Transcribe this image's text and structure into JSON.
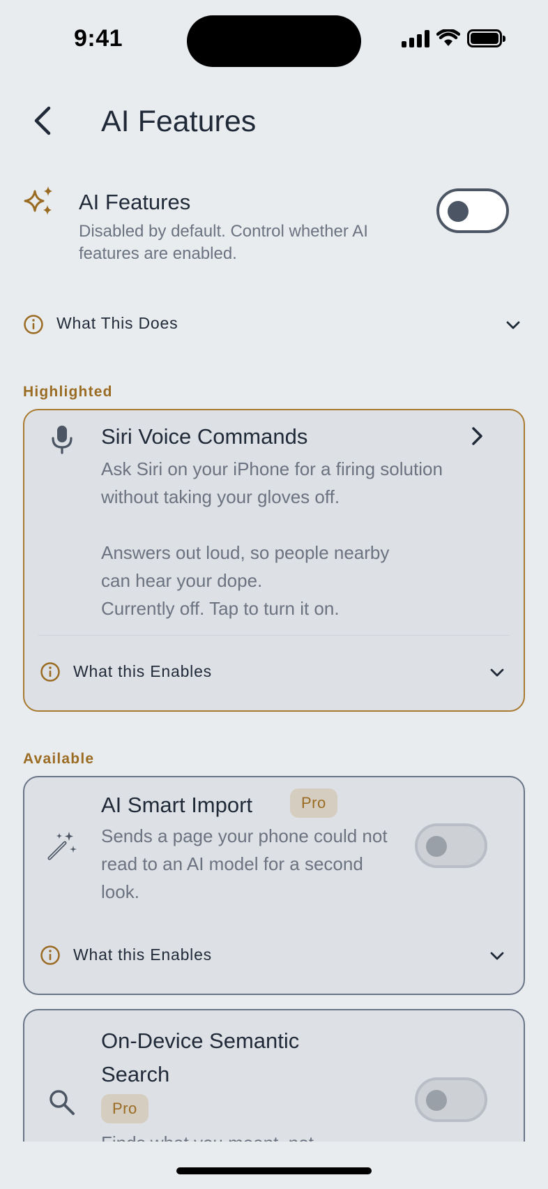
{
  "status": {
    "time": "9:41"
  },
  "nav": {
    "title": "AI Features"
  },
  "master": {
    "title": "AI Features",
    "description": "Disabled by default. Control whether AI features are enabled.",
    "icon": "sparkles-icon",
    "enabled": false
  },
  "what_this_does": {
    "label": "What This Does"
  },
  "sections": {
    "highlighted": "Highlighted",
    "available": "Available"
  },
  "siri": {
    "title": "Siri Voice Commands",
    "line1": "Ask Siri on your iPhone for a firing solution without taking your gloves off.",
    "line2": "Answers out loud, so people nearby can hear your dope.",
    "line3": "Currently off. Tap to turn it on.",
    "enables_label": "What this Enables",
    "icon": "microphone-icon"
  },
  "smart_import": {
    "title": "AI Smart Import",
    "badge": "Pro",
    "description": "Sends a page your phone could not read to an AI model for a second look.",
    "enables_label": "What this Enables",
    "icon": "magic-wand-icon",
    "enabled": false
  },
  "semantic_search": {
    "title": "On-Device Semantic Search",
    "badge": "Pro",
    "description": "Finds what you meant, not",
    "icon": "search-icon",
    "enabled": false
  },
  "colors": {
    "accent": "#9a6b22",
    "border": "#697386",
    "card_bg": "#dde0e5",
    "page_bg": "#e9ecef"
  }
}
